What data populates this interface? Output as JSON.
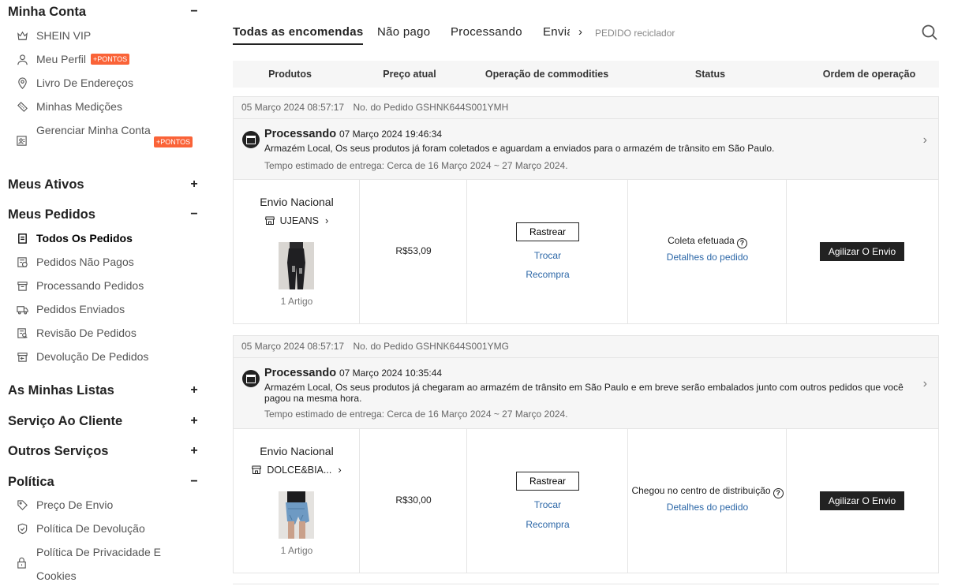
{
  "sidebar": {
    "sections": [
      {
        "title": "Minha Conta",
        "toggle": "−"
      },
      {
        "title": "Meus Ativos",
        "toggle": "+"
      },
      {
        "title": "Meus Pedidos",
        "toggle": "−"
      },
      {
        "title": "As Minhas Listas",
        "toggle": "+"
      },
      {
        "title": "Serviço Ao Cliente",
        "toggle": "+"
      },
      {
        "title": "Outros Serviços",
        "toggle": "+"
      },
      {
        "title": "Política",
        "toggle": "−"
      }
    ],
    "account_items": [
      {
        "label": "SHEIN VIP",
        "icon": "crown-icon"
      },
      {
        "label": "Meu Perfil",
        "icon": "person-icon",
        "badge": "+PONTOS"
      },
      {
        "label": "Livro De Endereços",
        "icon": "location-pin-icon"
      },
      {
        "label": "Minhas Medições",
        "icon": "ruler-icon"
      },
      {
        "label": "Gerenciar Minha Conta",
        "icon": "account-card-icon",
        "badge": "+PONTOS"
      }
    ],
    "order_items": [
      {
        "label": "Todos Os Pedidos",
        "icon": "document-icon",
        "active": true
      },
      {
        "label": "Pedidos Não Pagos",
        "icon": "invoice-icon"
      },
      {
        "label": "Processando Pedidos",
        "icon": "box-icon"
      },
      {
        "label": "Pedidos Enviados",
        "icon": "truck-icon"
      },
      {
        "label": "Revisão De Pedidos",
        "icon": "review-icon"
      },
      {
        "label": "Devolução De Pedidos",
        "icon": "return-box-icon"
      }
    ],
    "policy_items": [
      {
        "label": "Preço De Envio",
        "icon": "price-tag-icon"
      },
      {
        "label": "Política De Devolução",
        "icon": "shield-check-icon"
      },
      {
        "label": "Política De Privacidade E Cookies",
        "icon": "lock-icon"
      }
    ]
  },
  "tabs": {
    "items": [
      "Todas as encomendas",
      "Não pago",
      "Processando",
      "Enviado"
    ],
    "more_arrow": "›",
    "extra": "PEDIDO reciclador"
  },
  "table_headers": [
    "Produtos",
    "Preço atual",
    "Operação de commodities",
    "Status",
    "Ordem de operação"
  ],
  "orders": [
    {
      "date": "05 Março 2024 08:57:17",
      "order_no": "No. do Pedido GSHNK644S001YMH",
      "status_title": "Processando",
      "status_time": "07 Março 2024 19:46:34",
      "status_desc": "Armazém Local, Os seus produtos já foram coletados e aguardam a enviados para o armazém de trânsito em São Paulo.",
      "eta": "Tempo estimado de entrega: Cerca de 16 Março 2024 ~ 27 Março 2024.",
      "shipping": "Envio Nacional",
      "store": "UJEANS",
      "quantity": "1 Artigo",
      "price": "R$53,09",
      "actions": {
        "track": "Rastrear",
        "exchange": "Trocar",
        "rebuy": "Recompra"
      },
      "status": "Coleta efetuada",
      "details_link": "Detalhes do pedido",
      "operation": "Agilizar O Envio"
    },
    {
      "date": "05 Março 2024 08:57:17",
      "order_no": "No. do Pedido GSHNK644S001YMG",
      "status_title": "Processando",
      "status_time": "07 Março 2024 10:35:44",
      "status_desc": "Armazém Local, Os seus produtos já chegaram ao armazém de trânsito em São Paulo e em breve serão embalados junto com outros pedidos que você pagou na mesma hora.",
      "eta": "Tempo estimado de entrega: Cerca de 16 Março 2024 ~ 27 Março 2024.",
      "shipping": "Envio Nacional",
      "store": "DOLCE&BIA...",
      "quantity": "1 Artigo",
      "price": "R$30,00",
      "actions": {
        "track": "Rastrear",
        "exchange": "Trocar",
        "rebuy": "Recompra"
      },
      "status": "Chegou no centro de distribuição",
      "details_link": "Detalhes do pedido",
      "operation": "Agilizar O Envio"
    }
  ],
  "colors": {
    "badge": "#fa6338",
    "link": "#2d68a8",
    "dark_button": "#222222",
    "row_bg": "#f6f6f6"
  }
}
